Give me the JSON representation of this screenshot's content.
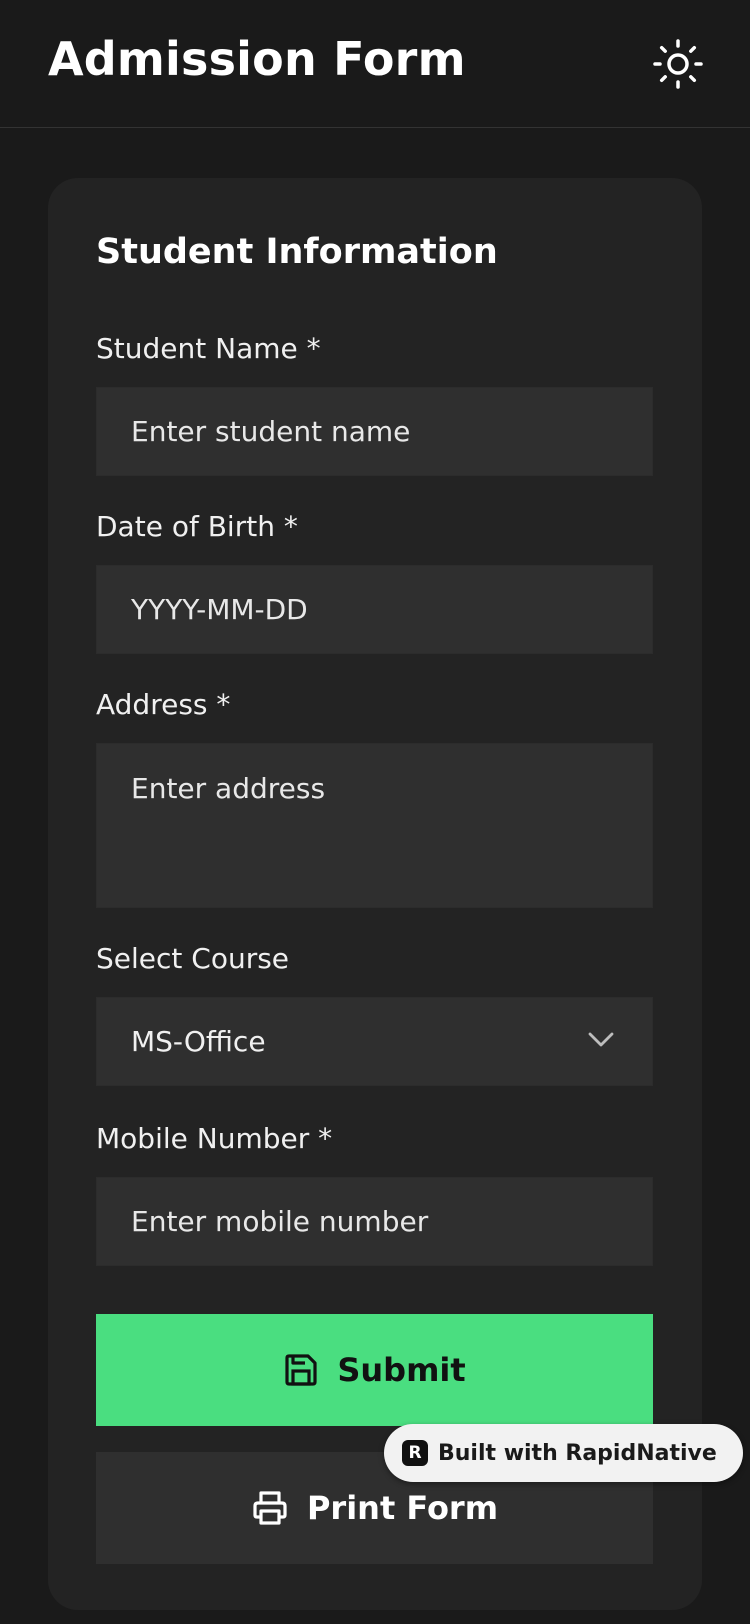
{
  "header": {
    "title": "Admission Form",
    "theme_icon": "sun-icon"
  },
  "form": {
    "section_title": "Student Information",
    "student_name": {
      "label": "Student Name *",
      "placeholder": "Enter student name",
      "value": ""
    },
    "date_of_birth": {
      "label": "Date of Birth *",
      "placeholder": "YYYY-MM-DD",
      "value": ""
    },
    "address": {
      "label": "Address *",
      "placeholder": "Enter address",
      "value": ""
    },
    "course": {
      "label": "Select Course",
      "selected": "MS-Office",
      "icon": "chevron-down-icon"
    },
    "mobile": {
      "label": "Mobile Number *",
      "placeholder": "Enter mobile number",
      "value": ""
    },
    "submit_label": "Submit",
    "submit_icon": "save-icon",
    "print_label": "Print Form",
    "print_icon": "printer-icon"
  },
  "badge": {
    "logo_letter": "R",
    "text": "Built with RapidNative"
  },
  "colors": {
    "background": "#1a1a1a",
    "card": "#232323",
    "input": "#2f2f2f",
    "accent": "#4ade80"
  }
}
